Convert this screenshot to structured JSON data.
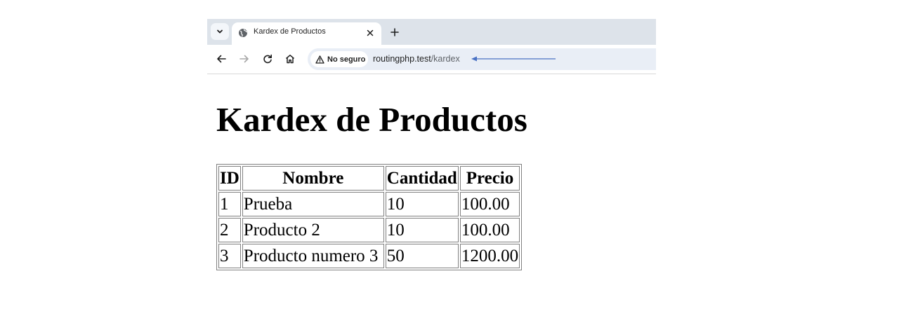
{
  "browser": {
    "tab": {
      "title": "Kardex de Productos"
    },
    "omnibox": {
      "security_label": "No seguro",
      "url_host": "routingphp.test",
      "url_path": "/kardex"
    },
    "icons": {
      "tab_search": "chevron-down-icon",
      "favicon": "globe-icon",
      "close": "close-icon",
      "new_tab": "plus-icon",
      "back": "back-arrow-icon",
      "forward": "forward-arrow-icon",
      "reload": "reload-icon",
      "home": "home-icon",
      "warning": "warning-triangle-icon"
    },
    "annotation_color": "#4a72c4"
  },
  "page": {
    "heading": "Kardex de Productos",
    "table": {
      "headers": [
        "ID",
        "Nombre",
        "Cantidad",
        "Precio"
      ],
      "rows": [
        [
          "1",
          "Prueba",
          "10",
          "100.00"
        ],
        [
          "2",
          "Producto 2",
          "10",
          "100.00"
        ],
        [
          "3",
          "Producto numero 3",
          "50",
          "1200.00"
        ]
      ]
    }
  }
}
